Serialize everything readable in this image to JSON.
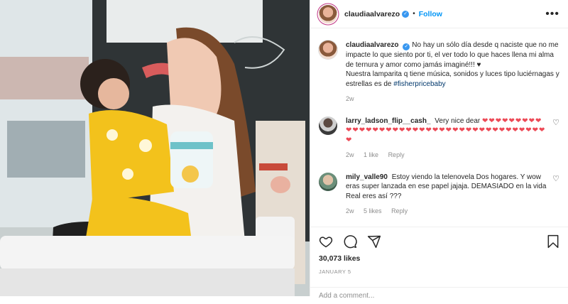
{
  "post": {
    "username": "claudiaalvarezo",
    "follow_label": "Follow",
    "separator": "•",
    "more_label": "•••"
  },
  "caption": {
    "username": "claudiaalvarezo",
    "text": "No hay un sólo día desde q naciste que no me impacte lo que siento por ti, el ver todo lo que haces llena mi alma de ternura y amor como jamás imaginé!!! ♥︎",
    "text2": "Nuestra lamparita q tiene música, sonidos y luces tipo luciérnagas y estrellas es de",
    "hashtag": "#fisherpricebaby",
    "time": "2w"
  },
  "comments": [
    {
      "username": "larry_ladson_flip__cash_",
      "text": "Very nice dear",
      "hearts": "❤❤❤❤❤❤❤❤❤❤❤❤❤❤❤❤❤❤❤❤❤❤❤❤❤❤❤❤❤❤❤❤❤❤❤❤❤❤❤❤",
      "time": "2w",
      "likes": "1 like",
      "reply": "Reply"
    },
    {
      "username": "mily_valle90",
      "text": "Estoy viendo la telenovela Dos hogares. Y wow eras super lanzada en ese papel jajaja. DEMASIADO en la vida Real eres así ???",
      "time": "2w",
      "likes": "5 likes",
      "reply": "Reply"
    }
  ],
  "engagement": {
    "likes": "30,073 likes",
    "date": "JANUARY 5"
  },
  "add_comment": {
    "placeholder": "Add a comment..."
  },
  "colors": {
    "accent": "#0095f6",
    "heart": "#ed4956",
    "muted": "#8e8e8e"
  }
}
